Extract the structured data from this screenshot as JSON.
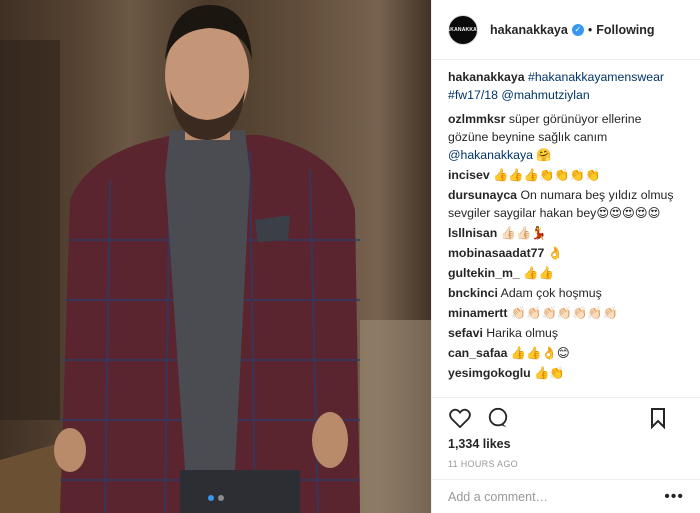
{
  "header": {
    "avatar_text": "HAKANAKKAYA",
    "username": "hakanakkaya",
    "verified_icon": "verified-badge-icon",
    "separator": "•",
    "follow_state": "Following"
  },
  "caption": {
    "username": "hakanakkaya",
    "hashtags": "#hakanakkayamenswear #fw17/18",
    "mention": "@mahmutziylan"
  },
  "comments": [
    {
      "user": "ozlmmksr",
      "text": "süper görünüyor ellerine gözüne beynine sağlık canım",
      "mention": "@hakanakkaya",
      "emoji": "🤗"
    },
    {
      "user": "incisev",
      "text": "",
      "mention": "",
      "emoji": "👍👍👍👏👏👏👏"
    },
    {
      "user": "dursunayca",
      "text": "On numara beş yıldız olmuş sevgiler saygilar hakan bey",
      "mention": "",
      "emoji": "😍😍😍😍😍"
    },
    {
      "user": "lsllnisan",
      "text": "",
      "mention": "",
      "emoji": "👍🏻👍🏻💃"
    },
    {
      "user": "mobinasaadat77",
      "text": "",
      "mention": "",
      "emoji": "👌"
    },
    {
      "user": "gultekin_m_",
      "text": "",
      "mention": "",
      "emoji": "👍👍"
    },
    {
      "user": "bnckinci",
      "text": "Adam çok hoşmuş",
      "mention": "",
      "emoji": ""
    },
    {
      "user": "minamertt",
      "text": "",
      "mention": "",
      "emoji": "👏🏻👏🏻👏🏻👏🏻👏🏻👏🏻👏🏻"
    },
    {
      "user": "sefavi",
      "text": "Harika olmuş",
      "mention": "",
      "emoji": ""
    },
    {
      "user": "can_safaa",
      "text": "",
      "mention": "",
      "emoji": "👍👍👌😊"
    },
    {
      "user": "yesimgokoglu",
      "text": "",
      "mention": "",
      "emoji": "👍👏"
    }
  ],
  "actions": {
    "like_icon": "heart-icon",
    "comment_icon": "comment-bubble-icon",
    "save_icon": "bookmark-icon"
  },
  "likes": "1,334 likes",
  "timestamp": "11 HOURS AGO",
  "add_comment": {
    "placeholder": "Add a comment…",
    "more_label": "•••"
  },
  "carousel": {
    "count": 2,
    "active": 0
  },
  "colors": {
    "accent": "#3897f0",
    "link": "#003569",
    "text": "#262626",
    "muted": "#999999"
  }
}
